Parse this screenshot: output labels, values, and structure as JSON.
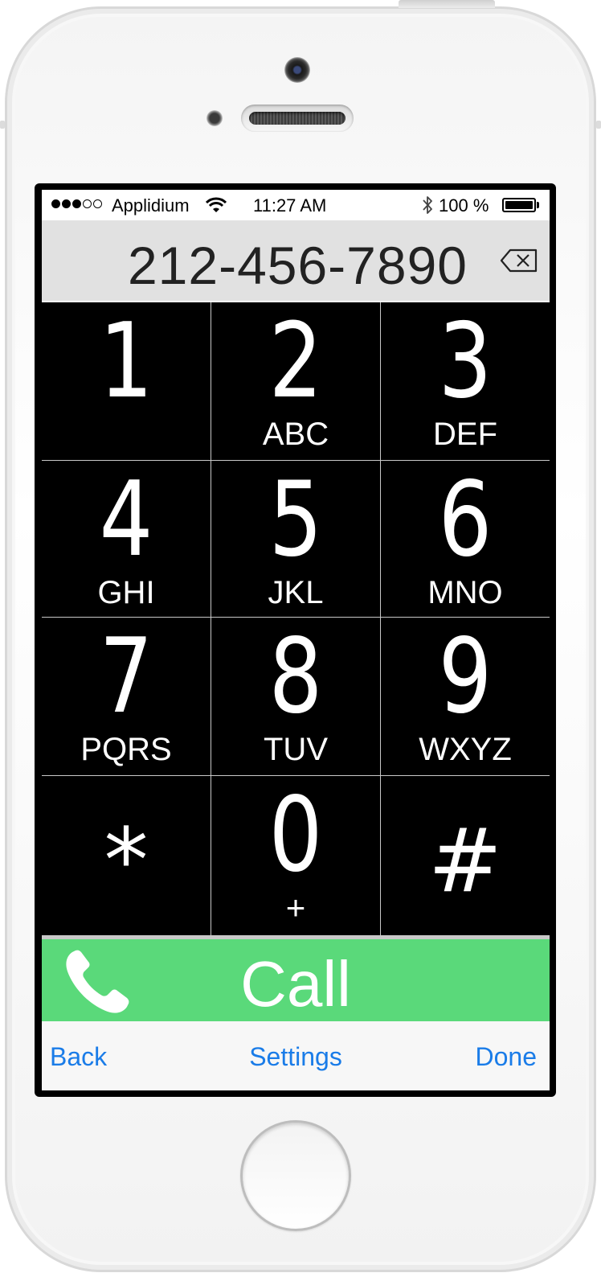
{
  "status_bar": {
    "signal_bars": [
      true,
      true,
      true,
      false,
      false
    ],
    "carrier": "Applidium",
    "time": "11:27 AM",
    "battery": "100 %",
    "icons": [
      "wifi-icon",
      "bluetooth-icon",
      "battery-icon"
    ]
  },
  "display": {
    "number": "212-456-7890",
    "backspace_icon": "backspace-icon"
  },
  "keypad": [
    {
      "digit": "1",
      "letters": ""
    },
    {
      "digit": "2",
      "letters": "ABC"
    },
    {
      "digit": "3",
      "letters": "DEF"
    },
    {
      "digit": "4",
      "letters": "GHI"
    },
    {
      "digit": "5",
      "letters": "JKL"
    },
    {
      "digit": "6",
      "letters": "MNO"
    },
    {
      "digit": "7",
      "letters": "PQRS"
    },
    {
      "digit": "8",
      "letters": "TUV"
    },
    {
      "digit": "9",
      "letters": "WXYZ"
    },
    {
      "digit": "*",
      "letters": ""
    },
    {
      "digit": "0",
      "letters": "+"
    },
    {
      "digit": "#",
      "letters": ""
    }
  ],
  "call": {
    "label": "Call",
    "icon": "phone-handset-icon",
    "color": "#5ad97a"
  },
  "toolbar": {
    "back": "Back",
    "settings": "Settings",
    "done": "Done",
    "link_color": "#1a7ce8"
  }
}
